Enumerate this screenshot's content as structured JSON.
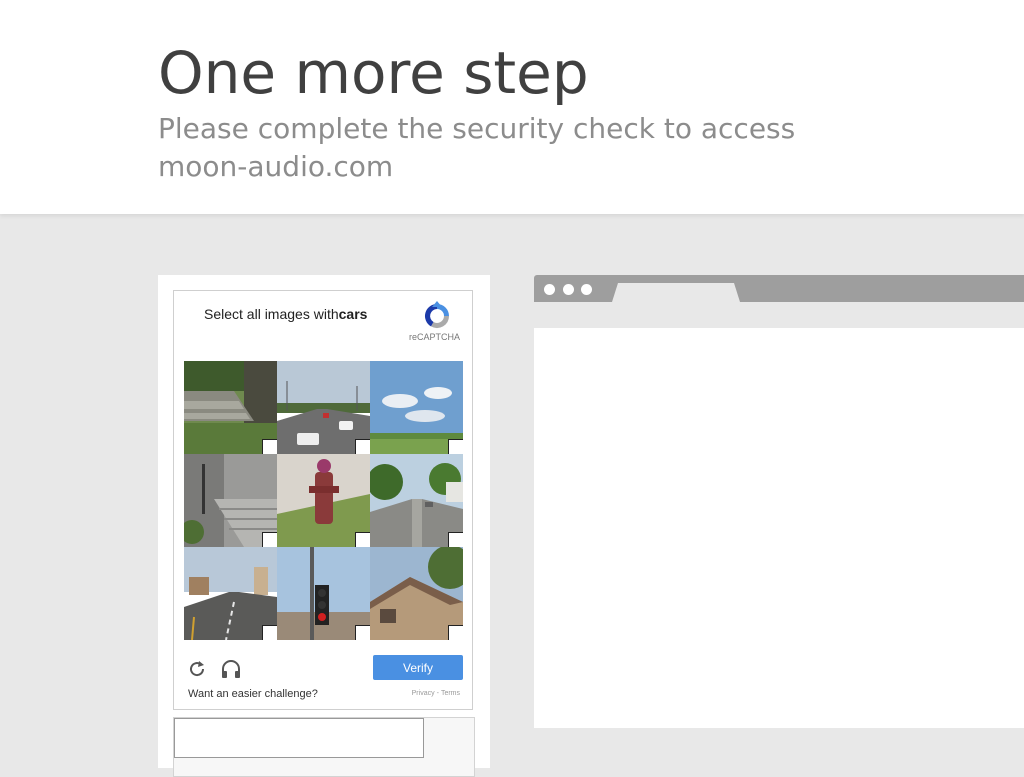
{
  "header": {
    "title": "One more step",
    "subtitle": "Please complete the security check to access moon-audio.com"
  },
  "captcha": {
    "prompt_prefix": "Select all images with",
    "prompt_target": "cars",
    "brand": "reCAPTCHA",
    "tiles": [
      {
        "icon": "stairs-yard-photo"
      },
      {
        "icon": "road-cars-photo"
      },
      {
        "icon": "sky-field-photo"
      },
      {
        "icon": "house-steps-photo"
      },
      {
        "icon": "fire-hydrant-photo"
      },
      {
        "icon": "tree-street-photo"
      },
      {
        "icon": "road-city-photo"
      },
      {
        "icon": "traffic-light-photo"
      },
      {
        "icon": "house-roof-photo"
      }
    ],
    "verify_label": "Verify",
    "easier_label": "Want an easier challenge?",
    "privacy_label": "Privacy",
    "terms_label": "Terms",
    "legal_separator": "-",
    "accent_color": "#4a90e2"
  },
  "colors": {
    "background": "#e8e8e8",
    "title": "#404040",
    "subtitle": "#8c8c8c",
    "browser_bar": "#9e9e9e"
  }
}
